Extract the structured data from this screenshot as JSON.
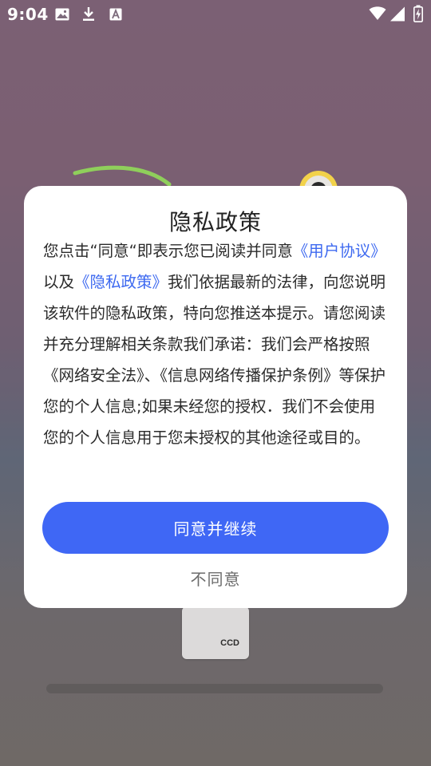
{
  "status_bar": {
    "time": "9:04",
    "left_icons": [
      "image-icon",
      "download-icon",
      "font-icon"
    ],
    "right_icons": [
      "wifi-icon",
      "signal-icon",
      "battery-charging-icon"
    ]
  },
  "dialog": {
    "title": "隐私政策",
    "body_parts": {
      "p1": "您点击“同意“即表示您已阅读并同意",
      "link_user_agreement": "《用户协议》",
      "p2": "以及",
      "link_privacy_policy": "《隐私政策》",
      "p3": "我们依据最新的法律，向您说明该软件的隐私政策，特向您推送本提示。请您阅读并充分理解相关条款我们承诺：我们会严格按照《网络安全法》、《信息网络传播保护条例》等保护您的个人信息;如果未经您的授权．我们不会使用您的个人信息用于您未授权的其他途径或目的。"
    },
    "agree_label": "同意并继续",
    "disagree_label": "不同意"
  },
  "background": {
    "phone_label": "CCD"
  },
  "colors": {
    "accent": "#3f67f5",
    "link": "#3d69f0"
  }
}
